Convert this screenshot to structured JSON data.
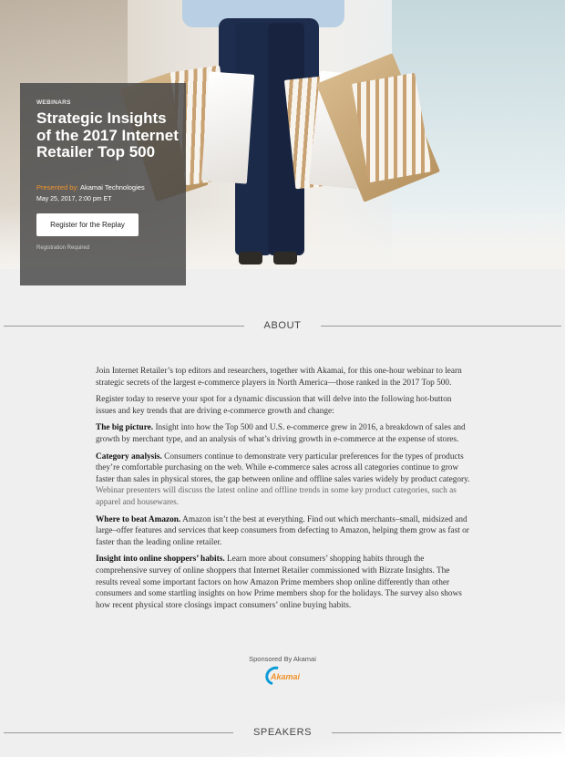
{
  "hero": {
    "eyebrow": "WEBINARS",
    "title": "Strategic Insights of the 2017 Internet Retailer Top 500",
    "presented_label": "Presented by:",
    "presenter": "Akamai Technologies",
    "date": "May 25, 2017, 2:00 pm ET",
    "cta_label": "Register for the Replay",
    "note": "Registration Required"
  },
  "sections": {
    "about_label": "ABOUT",
    "speakers_label": "SPEAKERS"
  },
  "about": {
    "intro": "Join Internet Retailer’s top editors and researchers, together with Akamai, for this one-hour webinar to learn strategic secrets of the largest e-commerce players in North America—those ranked in the 2017 Top 500.",
    "register": "Register today to reserve your spot for a dynamic discussion that will delve into the following hot-button issues and key trends that are driving e-commerce growth and change:",
    "items": [
      {
        "lead": "The big picture.",
        "text": "Insight into how the Top 500 and U.S. e-commerce grew in 2016, a breakdown of sales and growth by merchant type, and an analysis of what’s driving growth in e-commerce at the expense of stores.",
        "muted": ""
      },
      {
        "lead": "Category analysis.",
        "text": "Consumers continue to demonstrate very particular preferences for the types of products they’re comfortable purchasing on the web. While e-commerce sales across all categories continue to grow faster than sales in physical stores, the gap between online and offline sales varies widely by product category.",
        "muted": "Webinar presenters will discuss the latest online and offline trends in some key product categories, such as apparel and housewares."
      },
      {
        "lead": "Where to beat Amazon.",
        "text": "Amazon isn’t the best at everything. Find out which merchants–small, midsized and large–offer features and services that keep consumers from defecting to Amazon, helping them grow as fast or faster than the leading online retailer.",
        "muted": ""
      },
      {
        "lead": "Insight into online shoppers’ habits.",
        "text": "Learn more about consumers’ shopping habits through the comprehensive survey of online shoppers that Internet Retailer commissioned with Bizrate Insights. The results reveal some important factors on how Amazon Prime members shop online differently than other consumers and some startling insights on how Prime members shop for the holidays. The survey also shows how recent physical store closings impact consumers’ online buying habits.",
        "muted": ""
      }
    ]
  },
  "sponsor": {
    "label": "Sponsored By Akamai",
    "logo_text": "Akamai"
  },
  "colors": {
    "accent_orange": "#f0932b",
    "akamai_blue": "#0b9bd8",
    "card_bg": "#464646"
  }
}
